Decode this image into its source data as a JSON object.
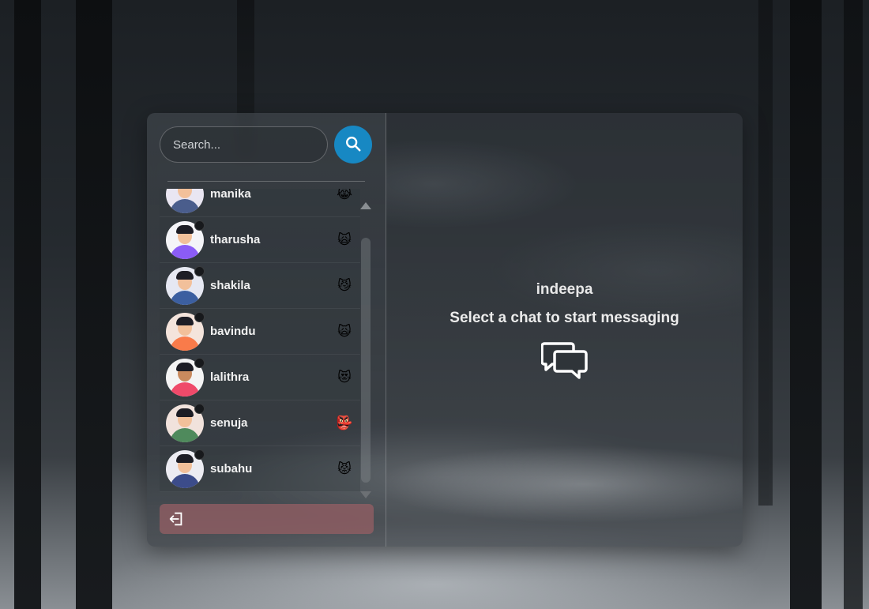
{
  "search": {
    "placeholder": "Search..."
  },
  "contacts": [
    {
      "name": "manika",
      "emoji": "😹",
      "skin": "#f2c09a",
      "body": "#4a5d8c",
      "bg": "#e9e6f2"
    },
    {
      "name": "tharusha",
      "emoji": "🙀",
      "skin": "#f2c09a",
      "body": "#8b5cf6",
      "bg": "#f4f4f8"
    },
    {
      "name": "shakila",
      "emoji": "😼",
      "skin": "#f2c09a",
      "body": "#3c5fa0",
      "bg": "#e6e8f2"
    },
    {
      "name": "bavindu",
      "emoji": "🙀",
      "skin": "#f2c09a",
      "body": "#f97b4a",
      "bg": "#f4e4dc"
    },
    {
      "name": "lalithra",
      "emoji": "😻",
      "skin": "#c98a5e",
      "body": "#ef4a6a",
      "bg": "#f4f4f4"
    },
    {
      "name": "senuja",
      "emoji": "👺",
      "skin": "#f2c09a",
      "body": "#4f8a5c",
      "bg": "#f1e2dc"
    },
    {
      "name": "subahu",
      "emoji": "😾",
      "skin": "#f2c09a",
      "body": "#3c4c8a",
      "bg": "#ececf2"
    }
  ],
  "welcome": {
    "username": "indeepa",
    "prompt": "Select a chat to start messaging"
  },
  "colors": {
    "accent": "#1788c3",
    "logout": "#965f64"
  },
  "icons": {
    "search": "search-icon",
    "logout": "logout-icon",
    "chat": "chat-bubbles-icon"
  }
}
